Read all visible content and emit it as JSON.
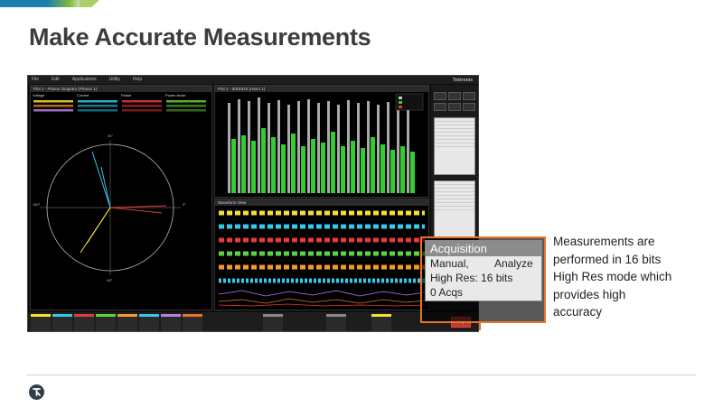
{
  "slide": {
    "title": "Make Accurate Measurements",
    "callout_lines": [
      "Measurements are",
      "performed in 16 bits",
      "High Res mode which",
      "provides high",
      "accuracy"
    ]
  },
  "scope": {
    "brand": "Tektronix",
    "menu": [
      "File",
      "Edit",
      "Applications",
      "Utility",
      "Help"
    ],
    "plot1_title": "Plot 1 - Phasor Diagram (Phasor 1)",
    "plot2_title": "Plot 2 - IEEE519 (Harm 1)",
    "waveform_title": "Waveform View",
    "table_headers": [
      "Voltage",
      "Current",
      "Phase",
      "Power factor"
    ],
    "run_label": "Stop"
  },
  "acquisition": {
    "title": "Acquisition",
    "mode": "Manual,",
    "action": "Analyze",
    "resolution": "High Res: 16 bits",
    "count": "0 Acqs"
  },
  "colors": {
    "ch1": "#f2e236",
    "ch2": "#35c8ea",
    "ch3": "#e33b3b",
    "ch4": "#5fd13a",
    "ch5": "#f29a2e",
    "ch6": "#b77ee6",
    "harmonics": "#33cc33",
    "limit": "#c8c8c8",
    "highlight": "#e8742c"
  },
  "icons": [
    "tektronix-logo-icon"
  ]
}
